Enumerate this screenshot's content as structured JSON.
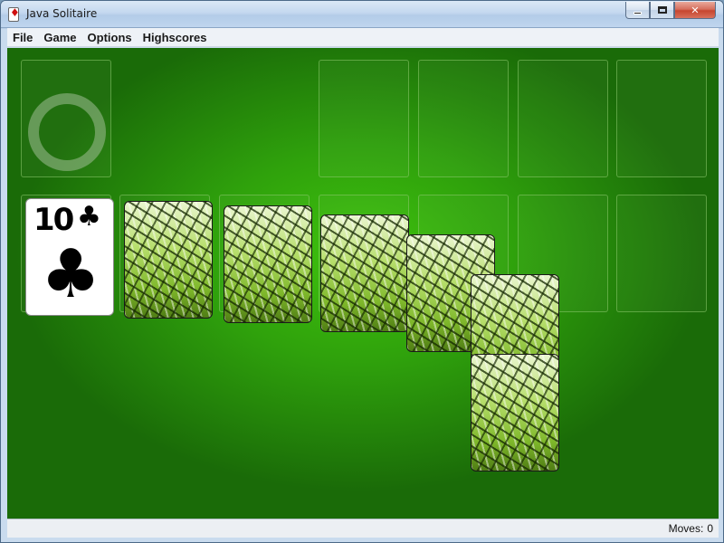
{
  "window": {
    "title": "Java Solitaire",
    "controls": {
      "minimize": "",
      "maximize": "",
      "close": "✕"
    }
  },
  "menubar": {
    "items": [
      "File",
      "Game",
      "Options",
      "Highscores"
    ]
  },
  "game": {
    "stock": {
      "state": "empty",
      "icon": "recycle-ring-icon"
    },
    "waste_card": {
      "rank": "10",
      "suit": "♣",
      "suit_name": "clubs",
      "face_up": true
    },
    "foundations": [
      "empty",
      "empty",
      "empty",
      "empty"
    ],
    "tableau": [
      {
        "column": 1,
        "face_down": 1,
        "face_up": 0
      },
      {
        "column": 2,
        "face_down": 1,
        "face_up": 0
      },
      {
        "column": 3,
        "face_down": 1,
        "face_up": 0
      },
      {
        "column": 4,
        "face_down": 1,
        "face_up": 0
      },
      {
        "column": 5,
        "face_down": 2,
        "face_up": 0
      },
      {
        "column": 6,
        "face_down": 0,
        "face_up": 0
      },
      {
        "column": 7,
        "face_down": 0,
        "face_up": 0
      }
    ],
    "colors": {
      "felt": "#3fc30e",
      "felt_dark": "#1a6b08",
      "card_back": "#8fc63a"
    }
  },
  "status": {
    "moves_label": "Moves:",
    "moves_value": "0"
  }
}
